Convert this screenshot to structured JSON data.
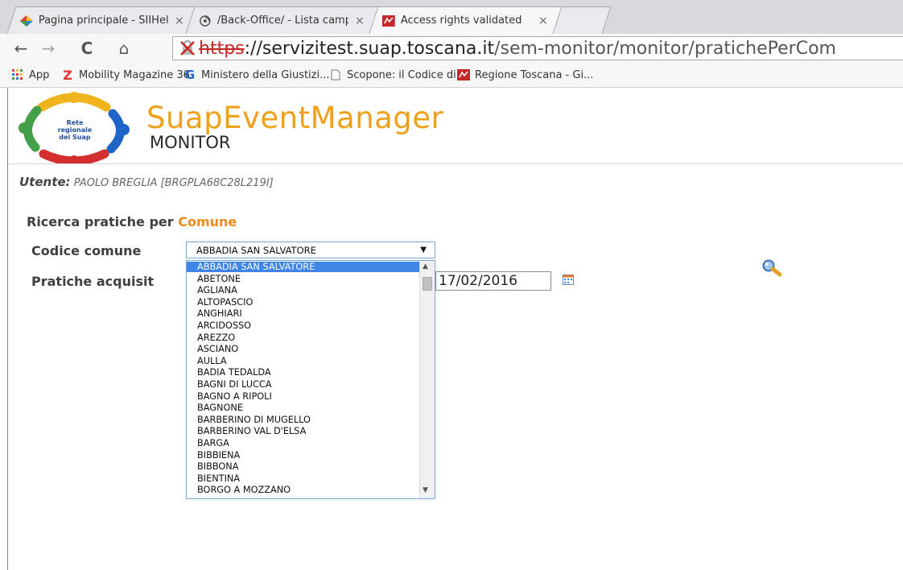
{
  "browser": {
    "tabs": [
      {
        "title": "Pagina principale - SIIHelp",
        "close": "×",
        "favicon": "colorful-diamond-icon"
      },
      {
        "title": "/Back-Office/ - Lista campi d",
        "close": "×",
        "favicon": "loading-icon"
      },
      {
        "title": "Access rights validated",
        "close": "×",
        "favicon": "regione-toscana-icon"
      }
    ],
    "address": {
      "scheme": "https",
      "host": "://servizitest.suap.toscana.it",
      "path": "/sem-monitor/monitor/pratichePerCom"
    },
    "bookmarks": [
      {
        "label": "App",
        "icon": "apps-grid-icon"
      },
      {
        "label": "Mobility Magazine 36",
        "icon": "z-logo-icon"
      },
      {
        "label": "Ministero della Giustizi...",
        "icon": "g-logo-icon"
      },
      {
        "label": "Scopone: il Codice di ...",
        "icon": "page-icon"
      },
      {
        "label": "Regione Toscana - Gi...",
        "icon": "regione-toscana-icon"
      }
    ],
    "colors": {
      "accent_orange": "#f0a11c",
      "selection_blue": "#3d86e6"
    }
  },
  "header": {
    "logo_text": "Rete regionale dei Suap",
    "title": "SuapEventManager",
    "subtitle": "MONITOR"
  },
  "user": {
    "label": "Utente:",
    "value": "PAOLO BREGLIA [BRGPLA68C28L219I]"
  },
  "search": {
    "title_prefix": "Ricerca pratiche per",
    "title_accent": "Comune",
    "codice_label": "Codice comune",
    "selected": "ABBADIA SAN SALVATORE",
    "pratiche_label": "Pratiche acquisit",
    "date_value": "17/02/2016"
  },
  "dropdown": {
    "options": [
      "ABBADIA SAN SALVATORE",
      "ABETONE",
      "AGLIANA",
      "ALTOPASCIO",
      "ANGHIARI",
      "ARCIDOSSO",
      "AREZZO",
      "ASCIANO",
      "AULLA",
      "BADIA TEDALDA",
      "BAGNI DI LUCCA",
      "BAGNO A RIPOLI",
      "BAGNONE",
      "BARBERINO DI MUGELLO",
      "BARBERINO VAL D'ELSA",
      "BARGA",
      "BIBBIENA",
      "BIBBONA",
      "BIENTINA",
      "BORGO A MOZZANO"
    ]
  }
}
